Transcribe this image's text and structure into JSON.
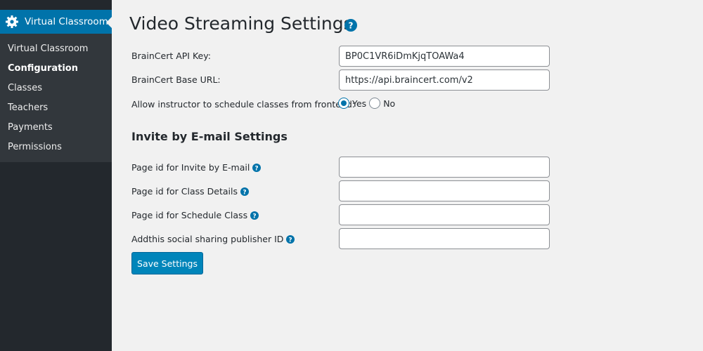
{
  "sidebar": {
    "plugin_title": "Virtual Classroom",
    "items": [
      {
        "label": "Virtual Classroom"
      },
      {
        "label": "Configuration"
      },
      {
        "label": "Classes"
      },
      {
        "label": "Teachers"
      },
      {
        "label": "Payments"
      },
      {
        "label": "Permissions"
      }
    ]
  },
  "page": {
    "title": "Video Streaming Settings"
  },
  "settings": {
    "api_key_label": "BrainCert API Key:",
    "api_key_value": "BP0C1VR6iDmKjqTOAWa4",
    "base_url_label": "BrainCert Base URL:",
    "base_url_value": "https://api.braincert.com/v2",
    "allow_label": "Allow instructor to schedule classes from frontend:",
    "yes_label": "Yes",
    "no_label": "No",
    "selected": "Yes"
  },
  "invite": {
    "section_title": "Invite by E-mail Settings",
    "invite_label": "Page id for Invite by E-mail",
    "invite_value": "",
    "class_details_label": "Page id for Class Details",
    "class_details_value": "",
    "schedule_label": "Page id for Schedule Class",
    "schedule_value": "",
    "addthis_label": "Addthis social sharing publisher ID",
    "addthis_value": ""
  },
  "actions": {
    "save_label": "Save Settings"
  },
  "colors": {
    "accent": "#0073aa",
    "sidebar_bg": "#23282d",
    "submenu_bg": "#32373c",
    "button_bg": "#0085ba"
  }
}
